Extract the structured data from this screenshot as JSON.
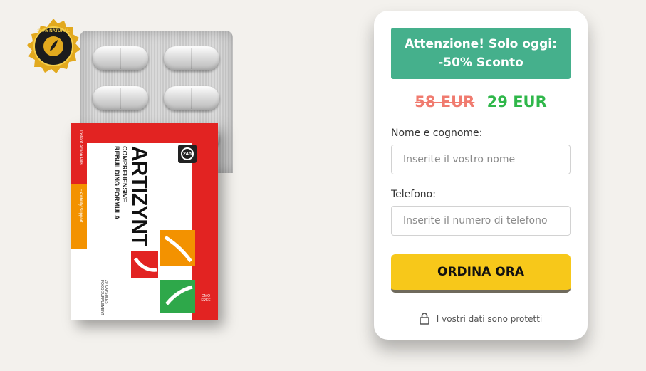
{
  "product": {
    "seal_text": "100% NATURAL",
    "brand": "ARTIZYNT",
    "tagline_line1": "COMPREHENSIVE",
    "tagline_line2": "REBUILDING FORMULA",
    "side_text_top": "Instant Action Pills",
    "side_text_bottom": "Flexibility Support",
    "footer_text_1": "FOOD SUPPLEMENT",
    "footer_text_2": "20 CAPSULES",
    "badge_text": "24h",
    "gmo_text": "GMO FREE"
  },
  "form": {
    "promo_line1": "Attenzione! Solo oggi:",
    "promo_line2": "-50% Sconto",
    "old_price": "58 EUR",
    "new_price": "29 EUR",
    "name_label": "Nome e cognome:",
    "name_placeholder": "Inserite il vostro nome",
    "phone_label": "Telefono:",
    "phone_placeholder": "Inserite il numero di telefono",
    "submit_label": "ORDINA ORA",
    "secure_text": "I vostri dati sono protetti"
  },
  "colors": {
    "background": "#f3f1ed",
    "promo": "#45b08c",
    "old_price": "#f07b6f",
    "new_price": "#2fb74a",
    "button": "#f7c81a",
    "box_red": "#e22322",
    "box_orange": "#f39200"
  }
}
